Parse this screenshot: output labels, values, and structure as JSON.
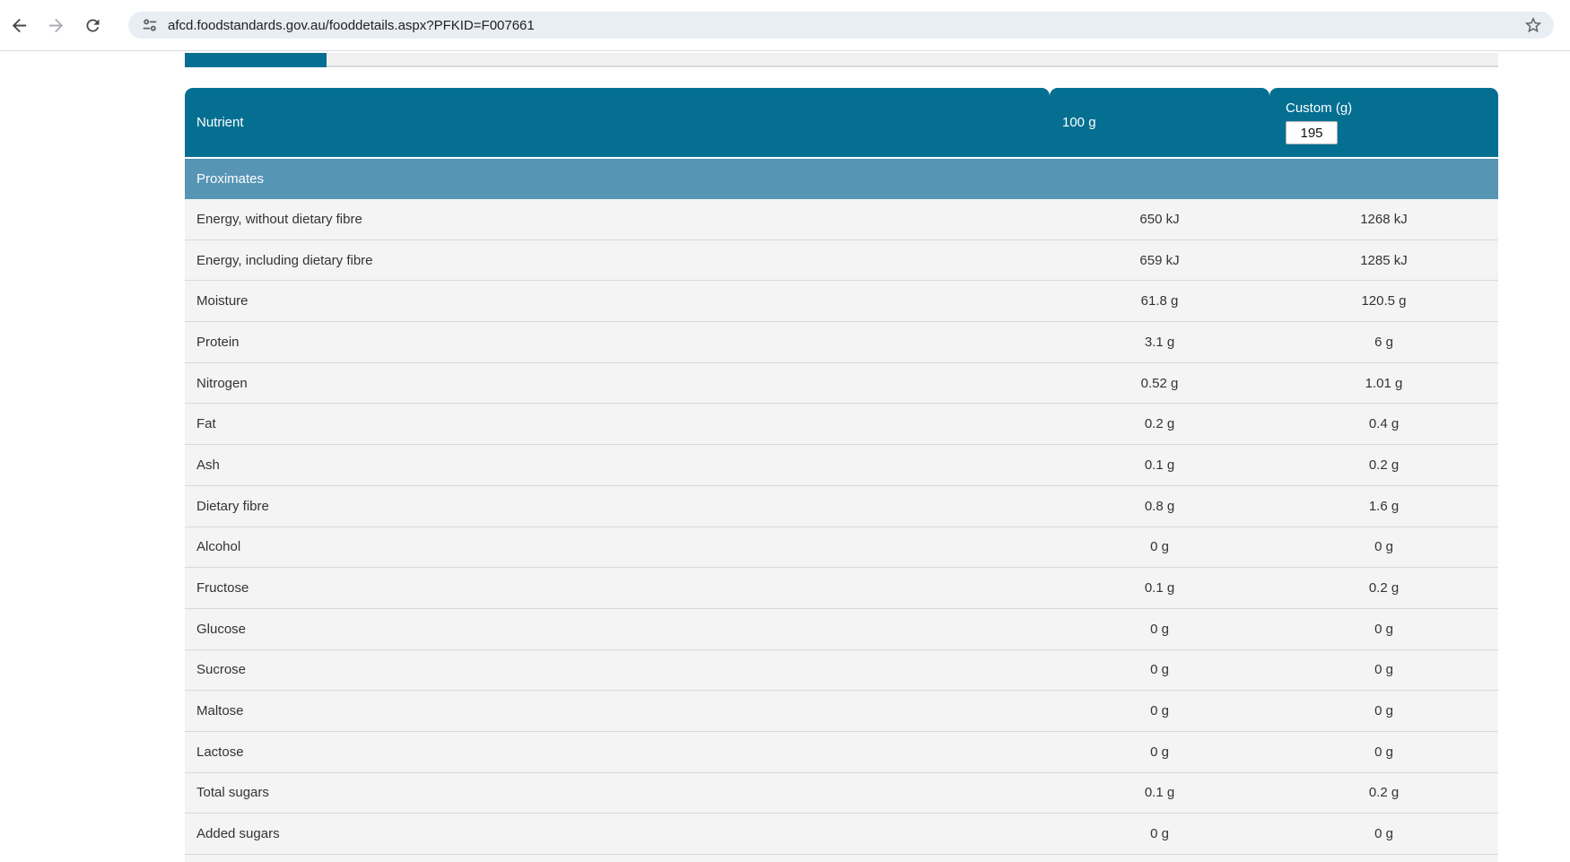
{
  "browser": {
    "url": "afcd.foodstandards.gov.au/fooddetails.aspx?PFKID=F007661",
    "icons": {
      "back": "back-arrow-icon",
      "forward": "forward-arrow-icon",
      "refresh": "refresh-icon",
      "site_info": "site-info-tune-icon",
      "bookmark": "bookmark-star-icon"
    }
  },
  "page_tabs": {
    "active_tab_label": ""
  },
  "table": {
    "headers": {
      "nutrient": "Nutrient",
      "per_100g": "100 g",
      "custom": "Custom (g)"
    },
    "custom_input_value": "195",
    "section_label": "Proximates",
    "rows": [
      {
        "nutrient": "Energy, without dietary fibre",
        "per100": "650 kJ",
        "custom": "1268 kJ"
      },
      {
        "nutrient": "Energy, including dietary fibre",
        "per100": "659 kJ",
        "custom": "1285 kJ"
      },
      {
        "nutrient": "Moisture",
        "per100": "61.8 g",
        "custom": "120.5 g"
      },
      {
        "nutrient": "Protein",
        "per100": "3.1 g",
        "custom": "6 g"
      },
      {
        "nutrient": "Nitrogen",
        "per100": "0.52 g",
        "custom": "1.01 g"
      },
      {
        "nutrient": "Fat",
        "per100": "0.2 g",
        "custom": "0.4 g"
      },
      {
        "nutrient": "Ash",
        "per100": "0.1 g",
        "custom": "0.2 g"
      },
      {
        "nutrient": "Dietary fibre",
        "per100": "0.8 g",
        "custom": "1.6 g"
      },
      {
        "nutrient": "Alcohol",
        "per100": "0 g",
        "custom": "0 g"
      },
      {
        "nutrient": "Fructose",
        "per100": "0.1 g",
        "custom": "0.2 g"
      },
      {
        "nutrient": "Glucose",
        "per100": "0 g",
        "custom": "0 g"
      },
      {
        "nutrient": "Sucrose",
        "per100": "0 g",
        "custom": "0 g"
      },
      {
        "nutrient": "Maltose",
        "per100": "0 g",
        "custom": "0 g"
      },
      {
        "nutrient": "Lactose",
        "per100": "0 g",
        "custom": "0 g"
      },
      {
        "nutrient": "Total sugars",
        "per100": "0.1 g",
        "custom": "0.2 g"
      },
      {
        "nutrient": "Added sugars",
        "per100": "0 g",
        "custom": "0 g"
      }
    ]
  },
  "colors": {
    "accent_teal": "#056f92",
    "section_blue": "#5795b5",
    "row_bg": "#f4f4f4",
    "row_divider": "#d9d9d9",
    "tabstrip_bg": "#f1f1f1",
    "omnibox_bg": "#e9edf4"
  }
}
